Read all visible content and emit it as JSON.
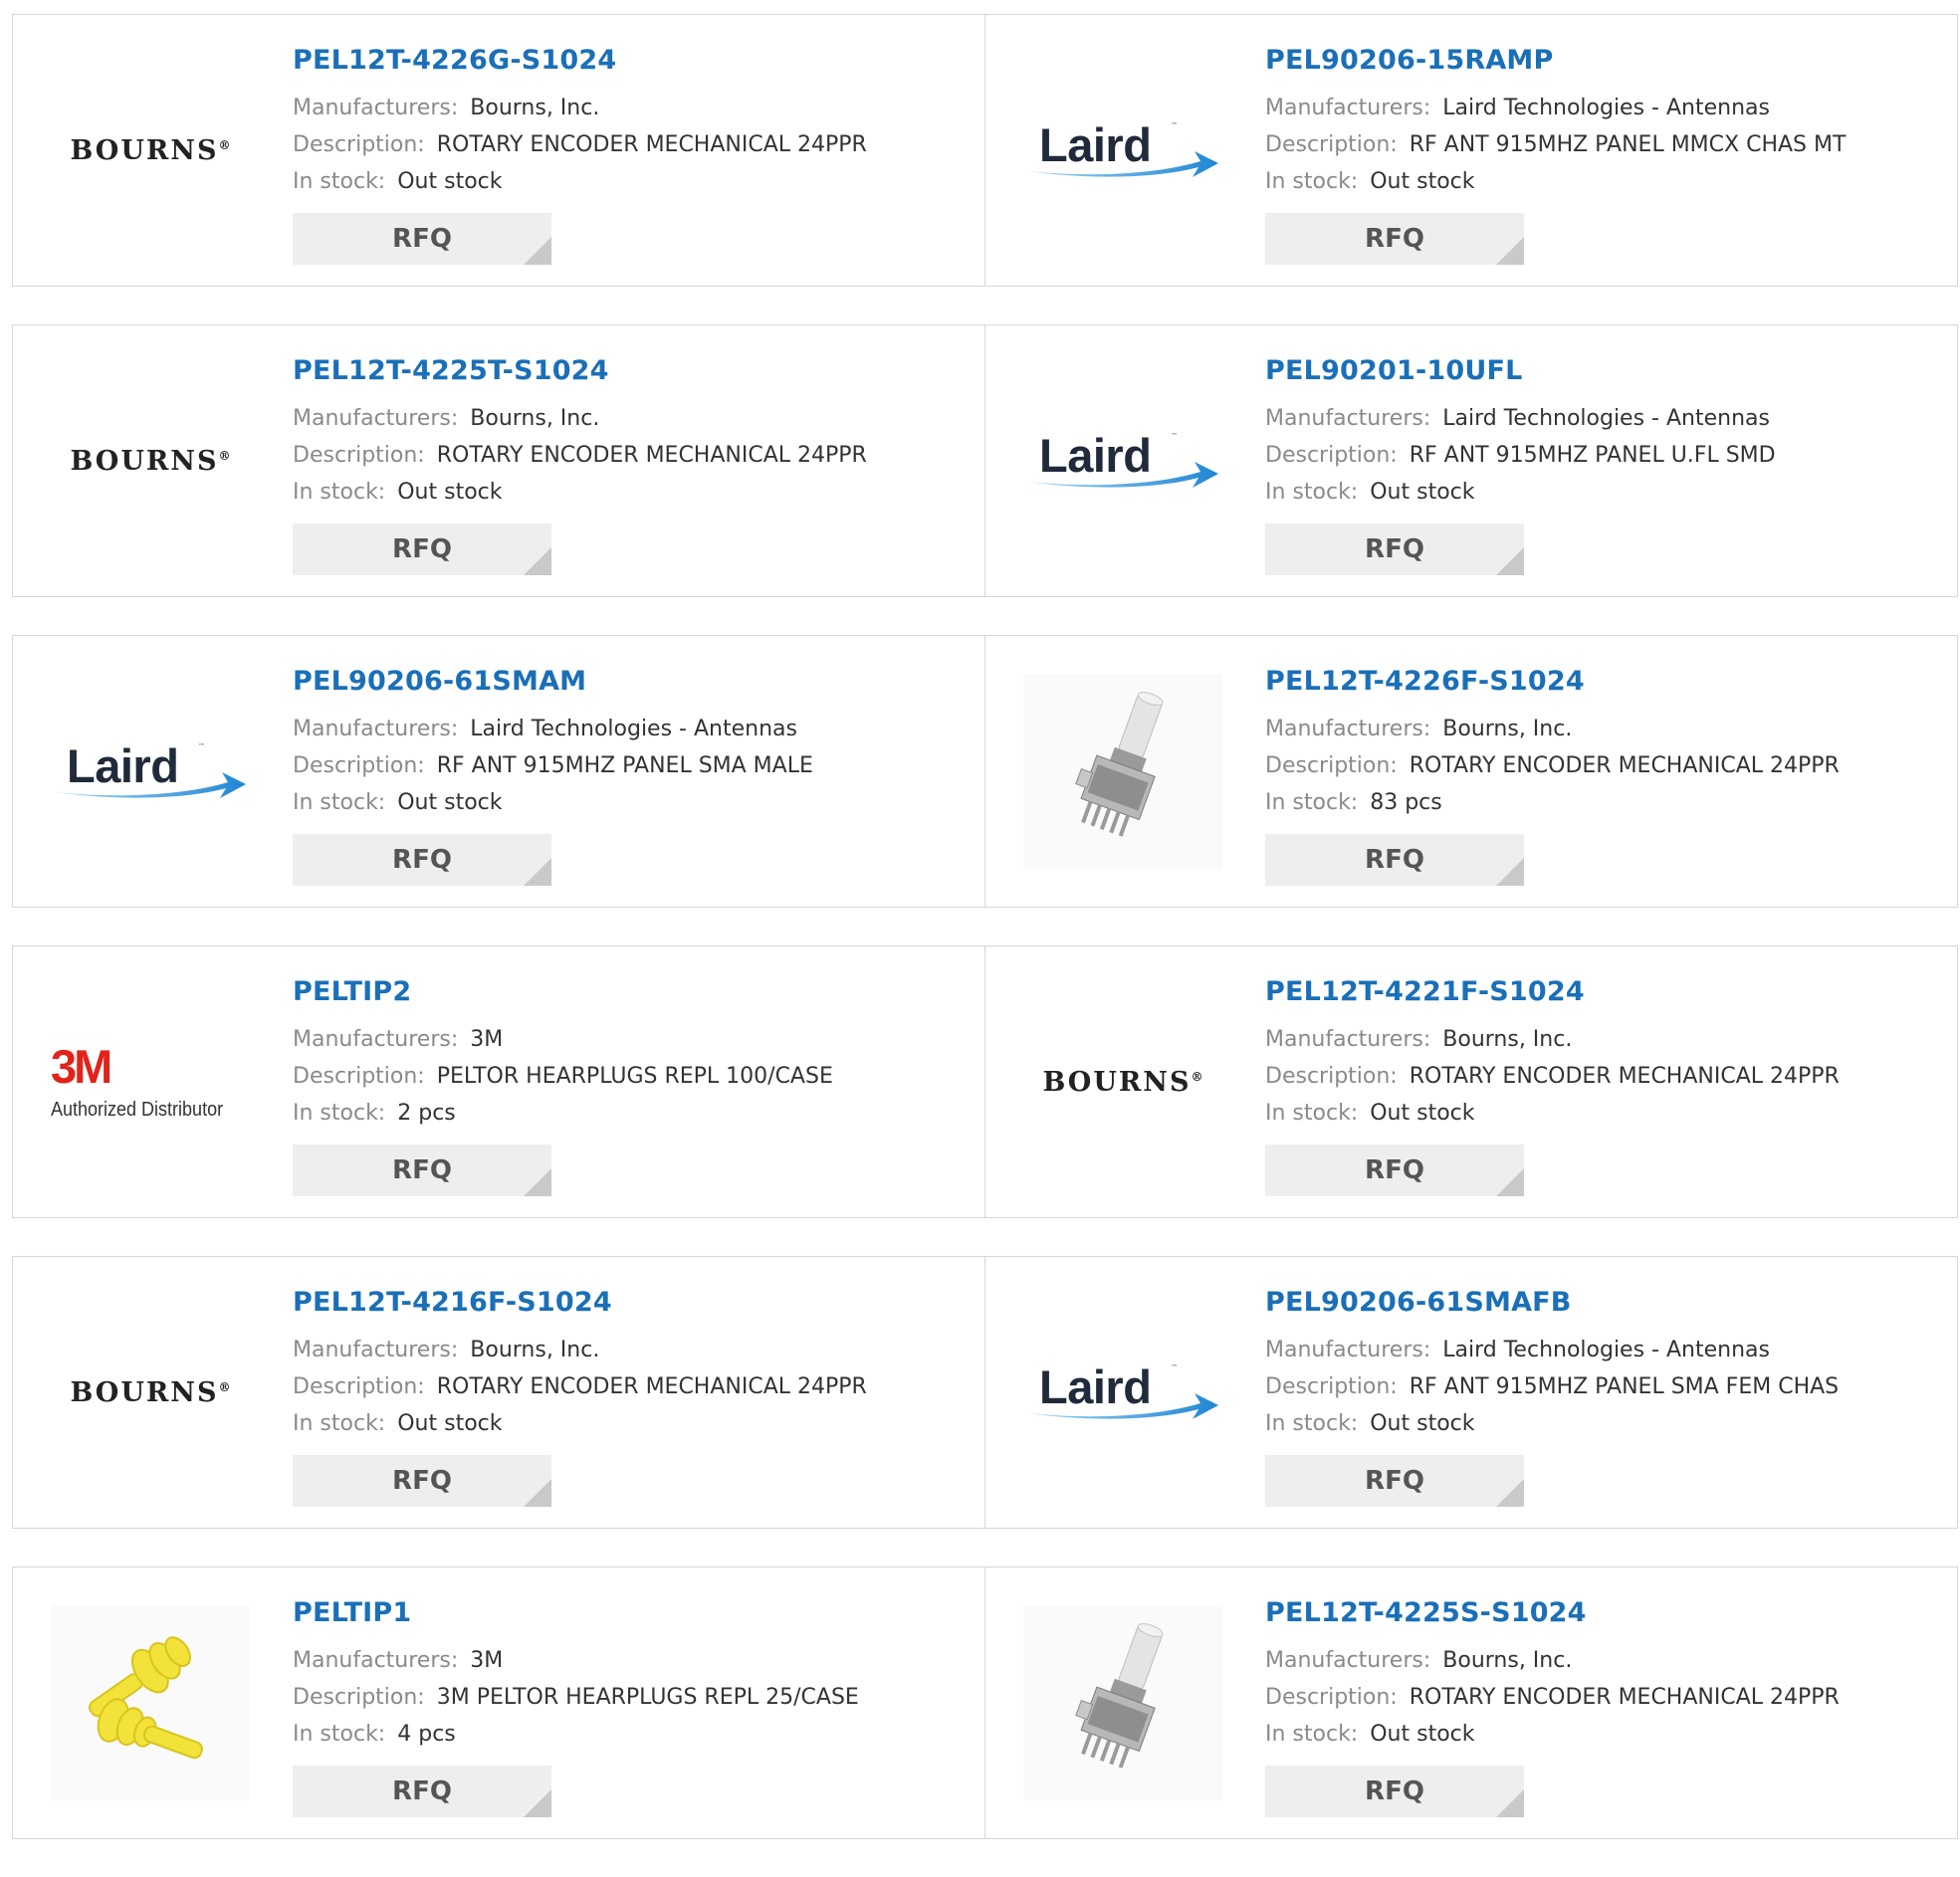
{
  "labels": {
    "manufacturers": "Manufacturers:",
    "description": "Description:",
    "in_stock": "In stock:",
    "rfq": "RFQ"
  },
  "colors": {
    "part_link": "#1a6fb8",
    "label_gray": "#8a8a8a",
    "rfq_bg": "#eeeeee",
    "border": "#d6d6d6",
    "brand_3m_red": "#e2231a",
    "laird_blue": "#2a8fd8"
  },
  "products": [
    {
      "part": "PEL12T-4226G-S1024",
      "manufacturer": "Bourns, Inc.",
      "description": "ROTARY ENCODER MECHANICAL 24PPR",
      "stock": "Out stock",
      "logo": "bourns"
    },
    {
      "part": "PEL90206-15RAMP",
      "manufacturer": "Laird Technologies - Antennas",
      "description": "RF ANT 915MHZ PANEL MMCX CHAS MT",
      "stock": "Out stock",
      "logo": "laird"
    },
    {
      "part": "PEL12T-4225T-S1024",
      "manufacturer": "Bourns, Inc.",
      "description": "ROTARY ENCODER MECHANICAL 24PPR",
      "stock": "Out stock",
      "logo": "bourns"
    },
    {
      "part": "PEL90201-10UFL",
      "manufacturer": "Laird Technologies - Antennas",
      "description": "RF ANT 915MHZ PANEL U.FL SMD",
      "stock": "Out stock",
      "logo": "laird"
    },
    {
      "part": "PEL90206-61SMAM",
      "manufacturer": "Laird Technologies - Antennas",
      "description": "RF ANT 915MHZ PANEL SMA MALE",
      "stock": "Out stock",
      "logo": "laird"
    },
    {
      "part": "PEL12T-4226F-S1024",
      "manufacturer": "Bourns, Inc.",
      "description": "ROTARY ENCODER MECHANICAL 24PPR",
      "stock": "83 pcs",
      "logo": "encoder-photo"
    },
    {
      "part": "PELTIP2",
      "manufacturer": "3M",
      "description": "PELTOR HEARPLUGS REPL 100/CASE",
      "stock": "2 pcs",
      "logo": "3m"
    },
    {
      "part": "PEL12T-4221F-S1024",
      "manufacturer": "Bourns, Inc.",
      "description": "ROTARY ENCODER MECHANICAL 24PPR",
      "stock": "Out stock",
      "logo": "bourns"
    },
    {
      "part": "PEL12T-4216F-S1024",
      "manufacturer": "Bourns, Inc.",
      "description": "ROTARY ENCODER MECHANICAL 24PPR",
      "stock": "Out stock",
      "logo": "bourns"
    },
    {
      "part": "PEL90206-61SMAFB",
      "manufacturer": "Laird Technologies - Antennas",
      "description": "RF ANT 915MHZ PANEL SMA FEM CHAS",
      "stock": "Out stock",
      "logo": "laird"
    },
    {
      "part": "PELTIP1",
      "manufacturer": "3M",
      "description": "3M PELTOR HEARPLUGS REPL 25/CASE",
      "stock": "4 pcs",
      "logo": "earplug-photo"
    },
    {
      "part": "PEL12T-4225S-S1024",
      "manufacturer": "Bourns, Inc.",
      "description": "ROTARY ENCODER MECHANICAL 24PPR",
      "stock": "Out stock",
      "logo": "encoder-photo"
    }
  ],
  "logos": {
    "bourns": "BOURNS",
    "bourns_reg": "®",
    "laird": "Laird",
    "laird_tm": "™",
    "3m_mark": "3M",
    "3m_sub": "Authorized Distributor"
  }
}
